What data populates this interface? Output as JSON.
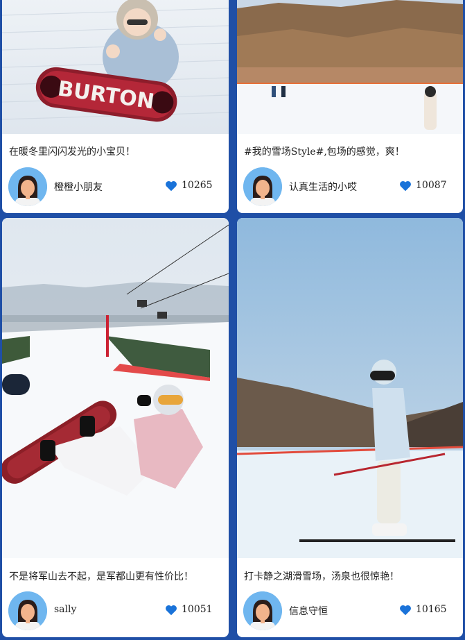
{
  "feed": {
    "posts": [
      {
        "caption": "在暖冬里闪闪发光的小宝贝！",
        "author": "橙橙小朋友",
        "likes": "10265",
        "board_text": "BURTON"
      },
      {
        "caption": "#我的雪场Style#,包场的感觉，爽！",
        "author": "认真生活的小哎",
        "likes": "10087"
      },
      {
        "caption": "不是将军山去不起，是军都山更有性价比！",
        "author": "sally",
        "likes": "10051"
      },
      {
        "caption": "打卡静之湖滑雪场，汤泉也很惊艳！",
        "author": "信息守恒",
        "likes": "10165"
      }
    ]
  },
  "colors": {
    "background": "#1f4fa6",
    "heart": "#1a73d9",
    "card": "#ffffff"
  },
  "icons": {
    "like": "heart-icon",
    "avatar": "avatar-icon"
  }
}
